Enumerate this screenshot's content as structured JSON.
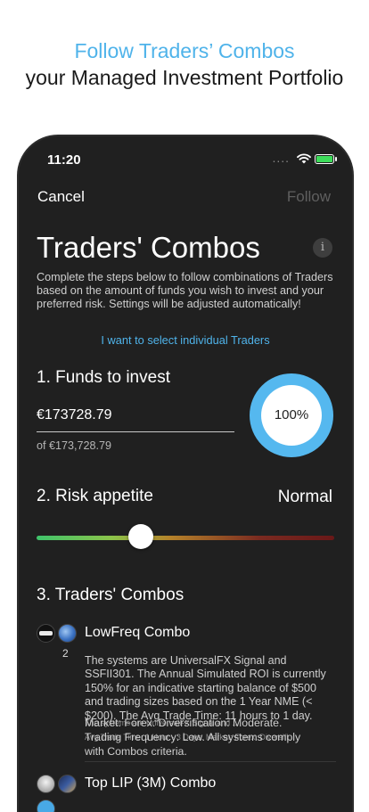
{
  "headline": {
    "title": "Follow Traders’ Combos",
    "subtitle": "your Managed Investment Portfolio"
  },
  "status_bar": {
    "time": "11:20",
    "signal": "....",
    "battery_color": "#3ddc5a"
  },
  "nav": {
    "cancel": "Cancel",
    "follow": "Follow"
  },
  "page": {
    "title": "Traders' Combos",
    "info_icon": "i",
    "description": "Complete the steps below to follow combinations of Traders based on the amount of funds you wish to invest and your preferred risk. Settings will be adjusted automatically!",
    "select_link": "I want to select individual Traders"
  },
  "funds": {
    "title": "1. Funds to invest",
    "value": "€173728.79",
    "available": "of €173,728.79",
    "percent_label": "100%",
    "percent_fraction": 1.0
  },
  "risk": {
    "title": "2. Risk appetite",
    "value": "Normal",
    "slider_fraction": 0.35
  },
  "combos": {
    "title": "3. Traders' Combos",
    "items": [
      {
        "name": "LowFreq Combo",
        "count": "2",
        "description": "The systems are UniversalFX Signal and SSFII301. The Annual Simulated ROI is currently 150% for an indicative starting balance of $500 and trading sizes based on the 1 Year NME (< $200). The Avg Trade Time: 11 hours to 1 day.",
        "overlap_line1": "Market: Forex. Diversification: Moderate.",
        "overlap_line2": "Trading Frequency: Low. All systems comply",
        "overlap_line3": "with Combos criteria.",
        "ghost_line1": "The systems are UniversalFX Signal and ...",
        "ghost_line2": "Avg Trade Time: 1 Hour - 3 Days. Market: Forex. Diversifi..."
      },
      {
        "name": "Top LIP (3M) Combo"
      }
    ]
  },
  "colors": {
    "accent": "#4fb3ea",
    "background": "#202020"
  }
}
